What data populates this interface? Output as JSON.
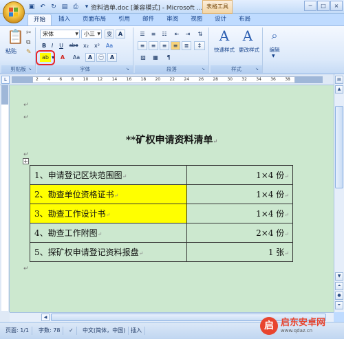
{
  "window": {
    "title": "资料清单.doc [兼容模式] - Microsoft ...",
    "context_tab": "表格工具",
    "controls": [
      "─",
      "□",
      "×"
    ]
  },
  "ribbon_tabs": [
    "开始",
    "插入",
    "页面布局",
    "引用",
    "邮件",
    "审阅",
    "视图",
    "设计",
    "布局"
  ],
  "active_tab": "开始",
  "clipboard": {
    "paste_label": "粘贴",
    "group_label": "剪贴板"
  },
  "font": {
    "name": "宋体",
    "size": "小三",
    "wen_label": "变",
    "wen_label2": "A",
    "bold": "B",
    "italic": "I",
    "underline": "U",
    "strike": "abe",
    "subscript": "x₂",
    "superscript": "x²",
    "highlight": "ab",
    "fontcolor": "A",
    "case": "Aa",
    "grow": "A",
    "shrink": "A",
    "charborder": "A",
    "enclosed": "㊀",
    "group_label": "字体"
  },
  "paragraph": {
    "group_label": "段落"
  },
  "styles": {
    "quick_label": "快速样式",
    "change_label": "更改样式",
    "group_label": "样式"
  },
  "editing": {
    "label": "编辑"
  },
  "ruler_ticks": [
    "2",
    "4",
    "6",
    "8",
    "10",
    "12",
    "14",
    "16",
    "18",
    "20",
    "22",
    "24",
    "26",
    "28",
    "30",
    "32",
    "34",
    "36",
    "38"
  ],
  "document": {
    "title": "**矿权申请资料清单",
    "rows": [
      {
        "item": "1、申请登记区块范围图",
        "qty": "1×4 份",
        "highlighted": false
      },
      {
        "item": "2、勘查单位资格证书",
        "qty": "1×4 份",
        "highlighted": true
      },
      {
        "item": "3、勘查工作设计书",
        "qty": "1×4 份",
        "highlighted": true
      },
      {
        "item": "4、勘查工作附图",
        "qty": "2×4 份",
        "highlighted": false
      },
      {
        "item": "5、探矿权申请登记资料报盘",
        "qty": "1 张",
        "highlighted": false
      }
    ],
    "para_mark": "↵",
    "table_handle": "+"
  },
  "status": {
    "page": "页面: 1/1",
    "words": "字数: 78",
    "language": "中文(简体，中国)",
    "mode": "插入"
  },
  "watermark": {
    "name_cn": "启东安卓网",
    "domain": "www.qdaz.cn",
    "logo_char": "启"
  },
  "colors": {
    "highlight": "#ffff00",
    "doc_background": "#cce8cf",
    "annotation": "#e8242a"
  }
}
